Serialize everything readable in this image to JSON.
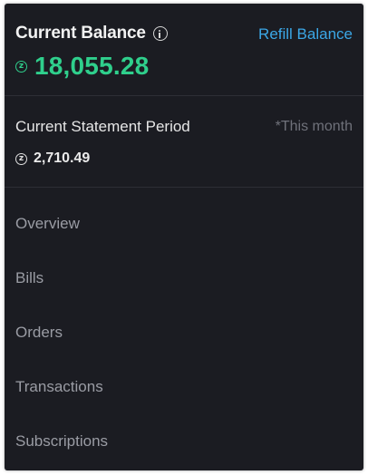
{
  "balance": {
    "title": "Current Balance",
    "refill_label": "Refill Balance",
    "currency_symbol": "z",
    "amount": "18,055.28"
  },
  "statement": {
    "label": "Current Statement Period",
    "period": "*This month",
    "currency_symbol": "z",
    "amount": "2,710.49"
  },
  "nav": {
    "items": [
      {
        "label": "Overview"
      },
      {
        "label": "Bills"
      },
      {
        "label": "Orders"
      },
      {
        "label": "Transactions"
      },
      {
        "label": "Subscriptions"
      }
    ]
  },
  "colors": {
    "panel_background": "#1b1c22",
    "balance_green": "#2fcf8c",
    "link_blue": "#3ba7e6",
    "muted_text": "#9a9ca4"
  }
}
